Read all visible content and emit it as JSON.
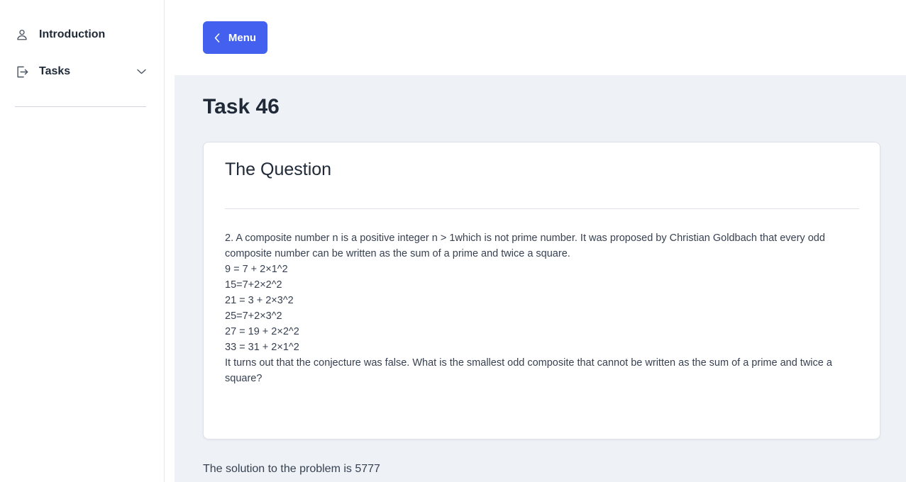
{
  "sidebar": {
    "items": [
      {
        "label": "Introduction",
        "icon": "user-icon"
      },
      {
        "label": "Tasks",
        "icon": "sign-out-icon",
        "expandable": true
      }
    ]
  },
  "topbar": {
    "menu_label": "Menu"
  },
  "main": {
    "title": "Task 46",
    "card": {
      "title": "The Question",
      "lines": [
        "2. A composite number n is a positive integer n > 1which is not prime number. It was proposed by Christian Goldbach that every odd composite number can be written as the sum of a prime and twice a square.",
        "9 = 7 + 2×1^2",
        "15=7+2×2^2",
        "21 = 3 + 2×3^2",
        "25=7+2×3^2",
        "27 = 19 + 2×2^2",
        "33 = 31 + 2×1^2",
        "It turns out that the conjecture was false. What is the smallest odd composite that cannot be written as the sum of a prime and twice a square?"
      ]
    },
    "solution": "The solution to the problem is 5777"
  },
  "colors": {
    "accent": "#4361ee",
    "main_bg": "#eef2f7",
    "text": "#1f2937"
  }
}
